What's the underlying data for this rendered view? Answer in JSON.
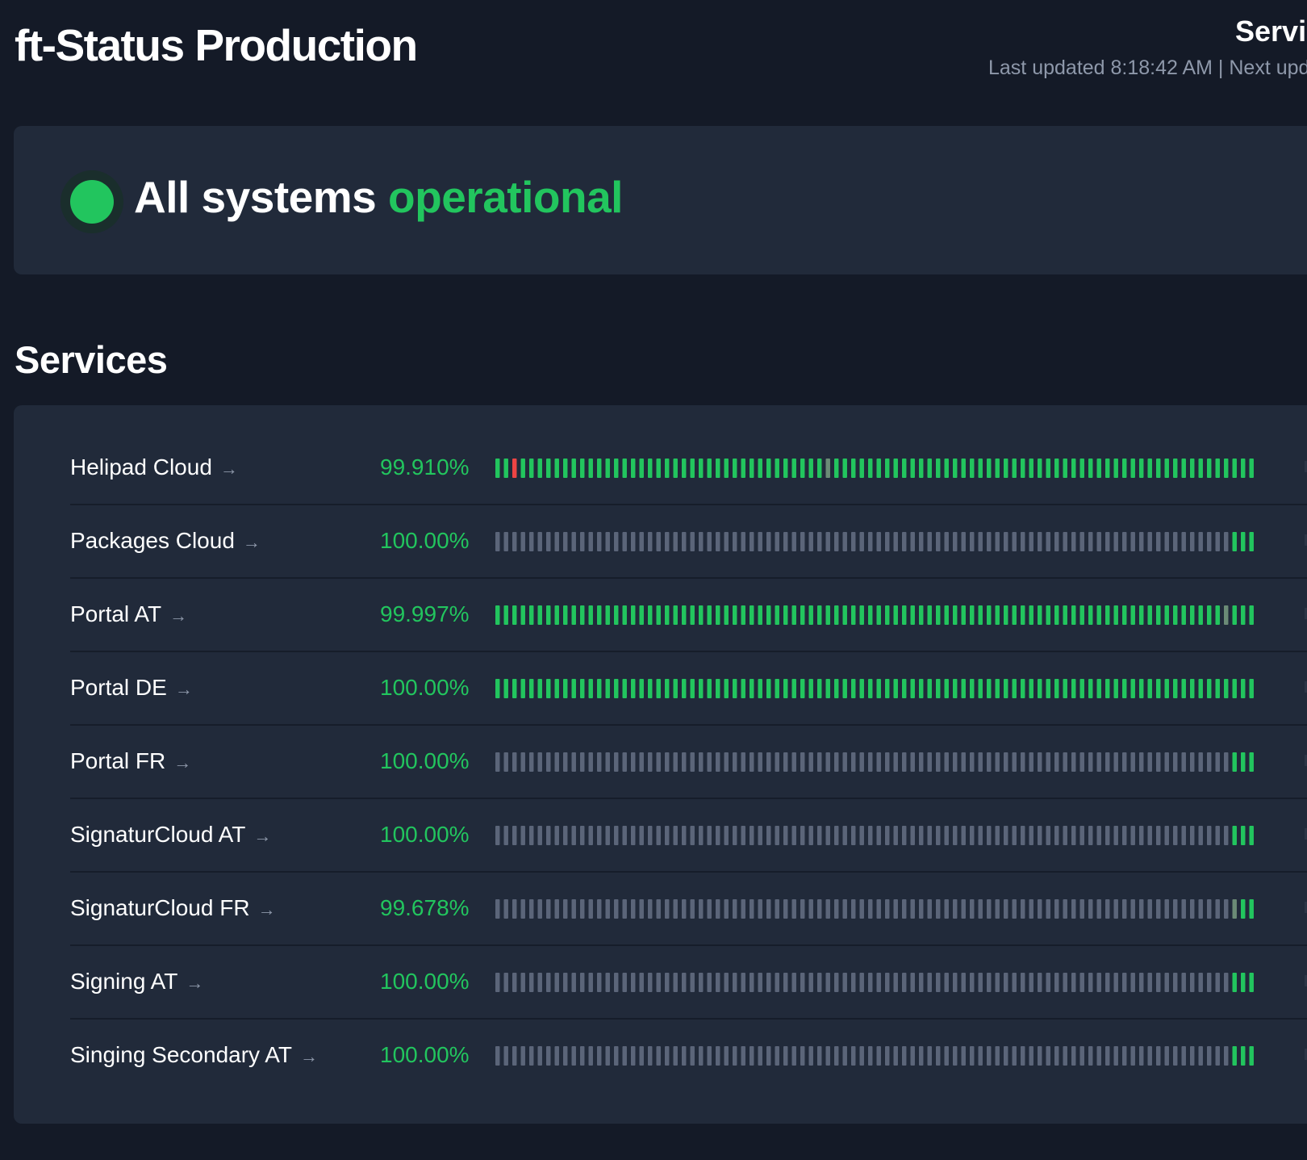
{
  "header": {
    "title": "ft-Status Production",
    "nav_link": "Servi",
    "last_updated": "Last updated 8:18:42 AM | Next upd"
  },
  "status": {
    "prefix": "All systems ",
    "highlight": "operational"
  },
  "services_section": {
    "title": "Services"
  },
  "colors": {
    "operational": "#22c55e",
    "no_data": "#5b6579",
    "incident": "#ef4444",
    "degraded": "#6b8b76"
  },
  "services": [
    {
      "name": "Helipad Cloud",
      "arrow": "→",
      "uptime": "99.910%",
      "history": {
        "total": 90,
        "no_data_days": 0,
        "incident_days": [
          2
        ],
        "degraded_days": [
          39
        ]
      }
    },
    {
      "name": "Packages Cloud",
      "arrow": "→",
      "uptime": "100.00%",
      "history": {
        "total": 90,
        "no_data_days": 87,
        "incident_days": [],
        "degraded_days": []
      }
    },
    {
      "name": "Portal AT",
      "arrow": "→",
      "uptime": "99.997%",
      "history": {
        "total": 90,
        "no_data_days": 0,
        "incident_days": [],
        "degraded_days": [
          86
        ]
      }
    },
    {
      "name": "Portal DE",
      "arrow": "→",
      "uptime": "100.00%",
      "history": {
        "total": 90,
        "no_data_days": 0,
        "incident_days": [],
        "degraded_days": []
      }
    },
    {
      "name": "Portal FR",
      "arrow": "→",
      "uptime": "100.00%",
      "history": {
        "total": 90,
        "no_data_days": 87,
        "incident_days": [],
        "degraded_days": []
      }
    },
    {
      "name": "SignaturCloud AT",
      "arrow": "→",
      "uptime": "100.00%",
      "history": {
        "total": 90,
        "no_data_days": 87,
        "incident_days": [],
        "degraded_days": []
      }
    },
    {
      "name": "SignaturCloud FR",
      "arrow": "→",
      "uptime": "99.678%",
      "history": {
        "total": 90,
        "no_data_days": 87,
        "incident_days": [],
        "degraded_days": [
          87
        ]
      }
    },
    {
      "name": "Signing AT",
      "arrow": "→",
      "uptime": "100.00%",
      "history": {
        "total": 90,
        "no_data_days": 87,
        "incident_days": [],
        "degraded_days": []
      }
    },
    {
      "name": "Singing Secondary AT",
      "arrow": "→",
      "uptime": "100.00%",
      "history": {
        "total": 90,
        "no_data_days": 87,
        "incident_days": [],
        "degraded_days": []
      }
    }
  ]
}
